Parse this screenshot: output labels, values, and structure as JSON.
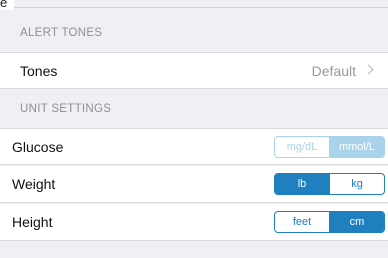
{
  "corner_label": "e",
  "alert_tones": {
    "header": "ALERT TONES",
    "tones_label": "Tones",
    "tones_value": "Default"
  },
  "unit_settings": {
    "header": "UNIT SETTINGS",
    "glucose": {
      "label": "Glucose",
      "options": [
        "mg/dL",
        "mmol/L"
      ],
      "selected": "mmol/L",
      "enabled": false
    },
    "weight": {
      "label": "Weight",
      "options": [
        "lb",
        "kg"
      ],
      "selected": "lb",
      "enabled": true
    },
    "height": {
      "label": "Height",
      "options": [
        "feet",
        "cm"
      ],
      "selected": "cm",
      "enabled": true
    }
  },
  "colors": {
    "accent": "#1f7fbf",
    "accent_faded": "#a9d3ea",
    "group_background": "#efeff4",
    "secondary_text": "#8e8e93"
  }
}
